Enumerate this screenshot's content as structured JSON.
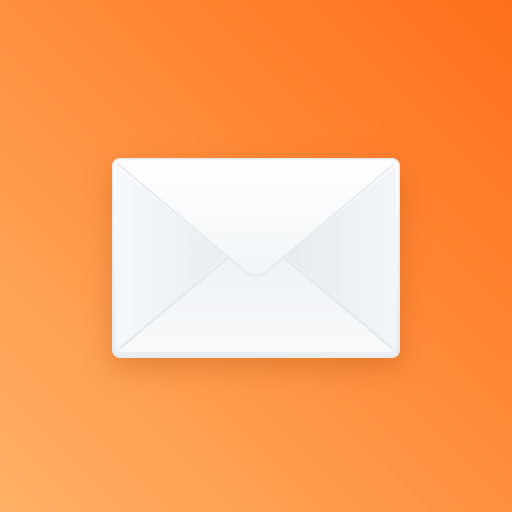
{
  "colors": {
    "background_light": "#ffb066",
    "background_dark": "#ff6f1a",
    "envelope_body": "#f3f6f8",
    "envelope_flap": "#fbfcfd"
  },
  "icons": {
    "main": "envelope-icon"
  }
}
